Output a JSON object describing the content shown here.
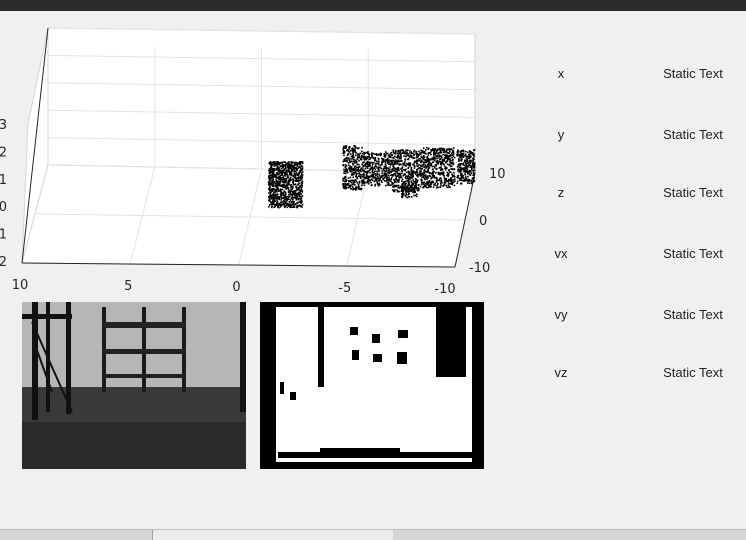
{
  "window": {
    "title": ""
  },
  "plot3d": {
    "x_ticks": [
      "10",
      "5",
      "0",
      "-5",
      "-10"
    ],
    "y_ticks": [
      "10",
      "0",
      "-10"
    ],
    "z_ticks": [
      "3",
      "2",
      "1",
      "0",
      "1",
      "2"
    ],
    "ylim": [
      -10,
      10
    ],
    "xlim": [
      -10,
      10
    ],
    "point_color": "#000000",
    "grid": true
  },
  "images": {
    "rgb": {
      "name": "rgb-camera-image"
    },
    "depth": {
      "name": "depth-mask-image"
    }
  },
  "readouts": [
    {
      "label": "x",
      "value": "Static Text"
    },
    {
      "label": "y",
      "value": "Static Text"
    },
    {
      "label": "z",
      "value": "Static Text"
    },
    {
      "label": "vx",
      "value": "Static Text"
    },
    {
      "label": "vy",
      "value": "Static Text"
    },
    {
      "label": "vz",
      "value": "Static Text"
    }
  ]
}
